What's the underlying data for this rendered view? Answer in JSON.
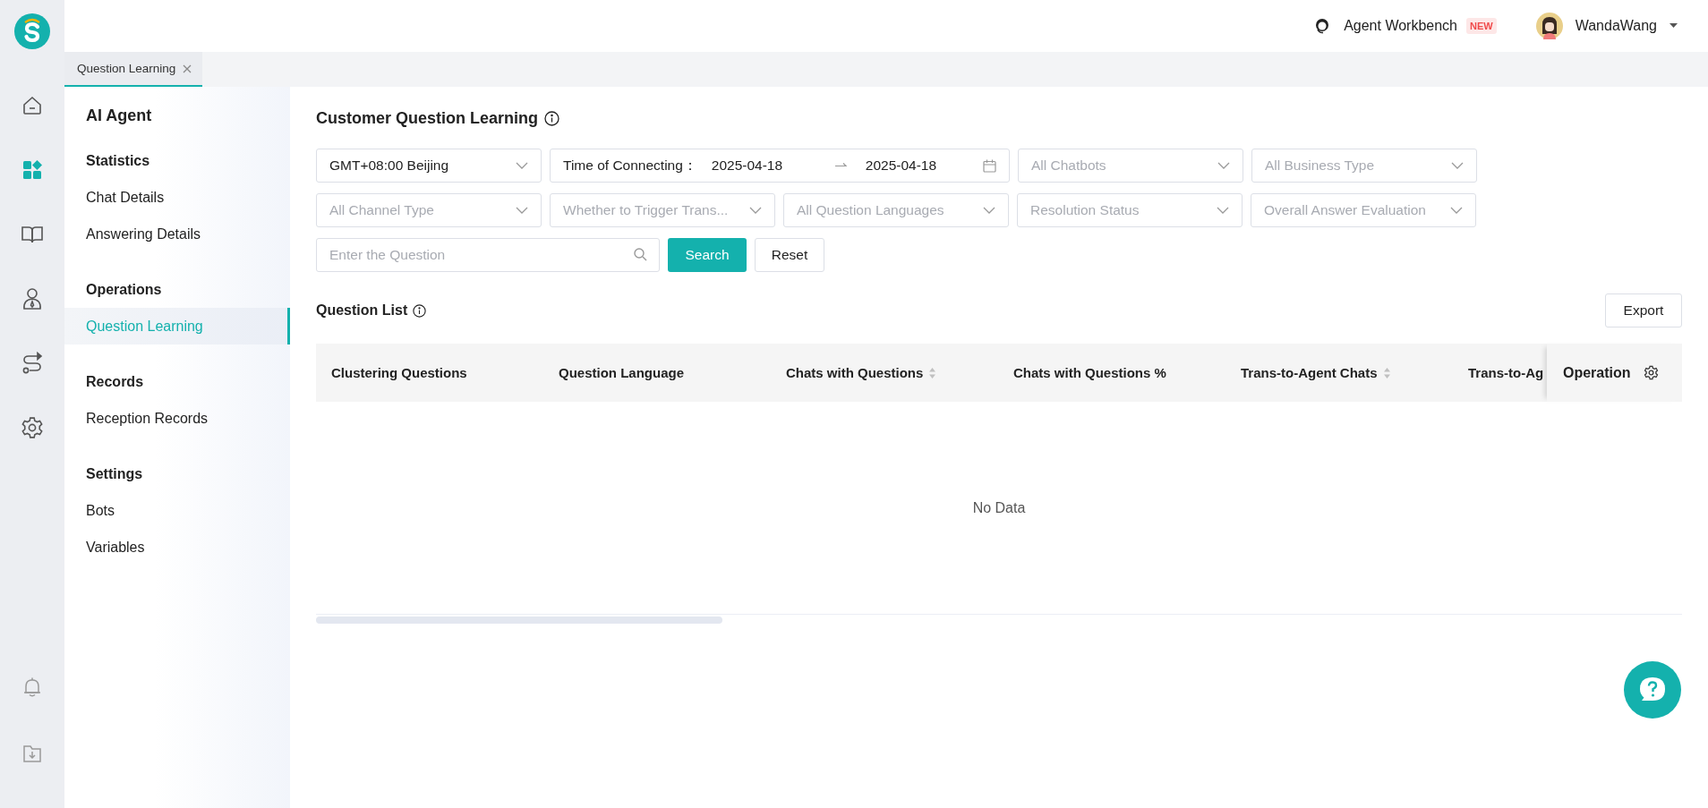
{
  "rail": {
    "items": [
      {
        "kind": "home",
        "selected": false
      },
      {
        "kind": "apps",
        "selected": true
      },
      {
        "kind": "book",
        "selected": false
      },
      {
        "kind": "agent",
        "selected": false
      },
      {
        "kind": "route",
        "selected": false
      },
      {
        "kind": "settings",
        "selected": false
      }
    ],
    "bottom": [
      {
        "kind": "bell"
      },
      {
        "kind": "download"
      }
    ]
  },
  "header": {
    "workbench": "Agent Workbench",
    "badge": "NEW",
    "user": "WandaWang"
  },
  "tabs": [
    {
      "label": "Question Learning",
      "selected": true,
      "closable": true
    }
  ],
  "sidebar": {
    "title": "AI Agent",
    "sections": [
      {
        "heading": "Statistics",
        "items": [
          {
            "label": "Chat Details",
            "selected": false
          },
          {
            "label": "Answering Details",
            "selected": false
          }
        ]
      },
      {
        "heading": "Operations",
        "items": [
          {
            "label": "Question Learning",
            "selected": true
          }
        ]
      },
      {
        "heading": "Records",
        "items": [
          {
            "label": "Reception Records",
            "selected": false
          }
        ]
      },
      {
        "heading": "Settings",
        "items": [
          {
            "label": "Bots",
            "selected": false
          },
          {
            "label": "Variables",
            "selected": false
          }
        ]
      }
    ]
  },
  "page": {
    "title": "Customer Question Learning"
  },
  "filters": [
    [
      {
        "kind": "select",
        "value": "GMT+08:00 Beijing"
      },
      {
        "kind": "daterange",
        "label": "Time of Connecting：",
        "start": "2025-04-18",
        "end": "2025-04-18"
      },
      {
        "kind": "select",
        "placeholder": "All Chatbots"
      },
      {
        "kind": "select",
        "placeholder": "All Business Type"
      }
    ],
    [
      {
        "kind": "select",
        "placeholder": "All Channel Type"
      },
      {
        "kind": "select",
        "placeholder": "Whether to Trigger Trans..."
      },
      {
        "kind": "select",
        "placeholder": "All Question Languages"
      },
      {
        "kind": "select",
        "placeholder": "Resolution Status"
      },
      {
        "kind": "select",
        "placeholder": "Overall Answer Evaluation"
      }
    ]
  ],
  "search": {
    "placeholder": "Enter the Question",
    "button": "Search",
    "reset": "Reset"
  },
  "list": {
    "title": "Question List",
    "export": "Export",
    "columns": [
      {
        "label": "Clustering Questions",
        "sortable": false
      },
      {
        "label": "Question Language",
        "sortable": false
      },
      {
        "label": "Chats with Questions",
        "sortable": true
      },
      {
        "label": "Chats with Questions %",
        "sortable": false
      },
      {
        "label": "Trans-to-Agent Chats",
        "sortable": true
      },
      {
        "label": "Trans-to-Ag"
      }
    ],
    "operation": "Operation",
    "empty": "No Data"
  }
}
